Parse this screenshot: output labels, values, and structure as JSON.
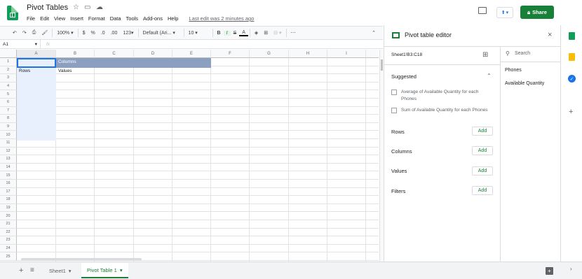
{
  "doc": {
    "title": "Pivot Tables",
    "last_edit": "Last edit was 2 minutes ago"
  },
  "menu": [
    "File",
    "Edit",
    "View",
    "Insert",
    "Format",
    "Data",
    "Tools",
    "Add-ons",
    "Help"
  ],
  "share_label": "Share",
  "toolbar": {
    "zoom": "100%",
    "currency": "$",
    "percent": "%",
    "dec_less": ".0",
    "dec_more": ".00",
    "format": "123",
    "font": "Default (Ari...",
    "size": "10",
    "bold": "B",
    "italic": "I",
    "strike": "S",
    "textcolor": "A",
    "more": "⋯"
  },
  "namebox": "A1",
  "fx": "fx",
  "columns": [
    "A",
    "B",
    "C",
    "D",
    "E",
    "F",
    "G",
    "H",
    "I"
  ],
  "rows": [
    "1",
    "2",
    "3",
    "4",
    "5",
    "6",
    "7",
    "8",
    "9",
    "10",
    "11",
    "12",
    "13",
    "14",
    "15",
    "16",
    "17",
    "18",
    "19",
    "20",
    "21",
    "22",
    "23",
    "24",
    "25"
  ],
  "cells": {
    "B1": "Columns",
    "A2": "Rows",
    "B2": "Values"
  },
  "sheets": [
    {
      "name": "Sheet1"
    },
    {
      "name": "Pivot Table 1"
    }
  ],
  "panel": {
    "title": "Pivot table editor",
    "range": "Sheet1!B3:C18",
    "suggested": "Suggested",
    "suggestions": [
      "Average of Available Quantity for each Phones",
      "Sum of Available Quantity for each Phones"
    ],
    "sections": [
      "Rows",
      "Columns",
      "Values",
      "Filters"
    ],
    "add_label": "Add",
    "search_placeholder": "Search",
    "fields": [
      "Phones",
      "Available Quantity"
    ]
  },
  "colors": {
    "accent": "#188038",
    "header_fill": "#8b9fc0",
    "pivot_area": "#e8f0fe"
  }
}
